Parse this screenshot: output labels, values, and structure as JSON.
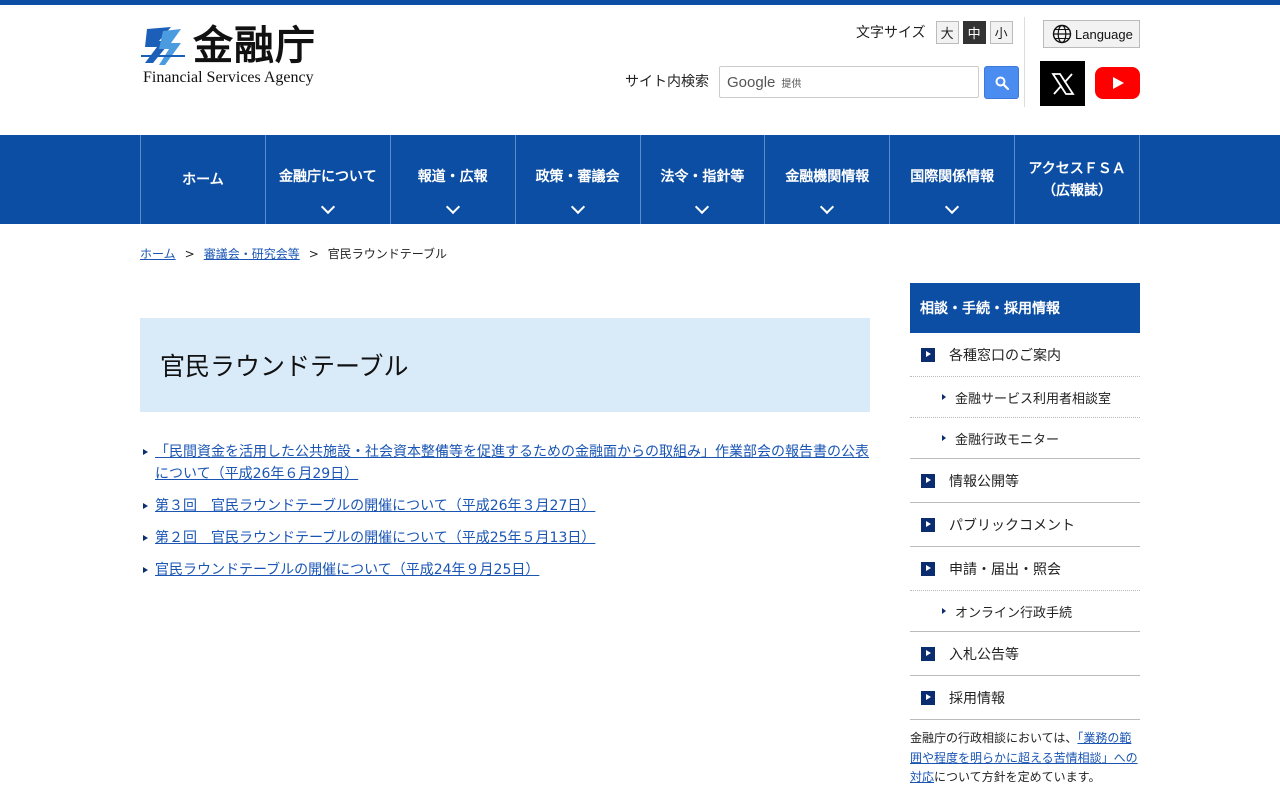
{
  "header": {
    "logo_kanji": "金融庁",
    "logo_en": "Financial Services Agency",
    "font_size_label": "文字サイズ",
    "font_sizes": [
      "大",
      "中",
      "小"
    ],
    "language_label": "Language",
    "search_label": "サイト内検索",
    "search_brand": "Google",
    "search_brand_suffix": "提供",
    "search_placeholder": ""
  },
  "nav": {
    "items": [
      {
        "label": "ホーム"
      },
      {
        "label": "金融庁について"
      },
      {
        "label": "報道・広報"
      },
      {
        "label": "政策・審議会"
      },
      {
        "label": "法令・指針等"
      },
      {
        "label": "金融機関情報"
      },
      {
        "label": "国際関係情報"
      },
      {
        "label": "アクセスＦＳＡ",
        "label2": "（広報誌）"
      }
    ]
  },
  "breadcrumb": {
    "home": "ホーム",
    "parent": "審議会・研究会等",
    "current": "官民ラウンドテーブル",
    "separator": ">"
  },
  "main": {
    "title": "官民ラウンドテーブル",
    "links": [
      "「民間資金を活用した公共施設・社会資本整備等を促進するための金融面からの取組み」作業部会の報告書の公表について（平成26年６月29日）",
      "第３回　官民ラウンドテーブルの開催について（平成26年３月27日）",
      "第２回　官民ラウンドテーブルの開催について（平成25年５月13日）",
      "官民ラウンドテーブルの開催について（平成24年９月25日）"
    ]
  },
  "sidebar": {
    "heading": "相談・手続・採用情報",
    "items": [
      {
        "label": "各種窓口のご案内"
      },
      {
        "label": "金融サービス利用者相談室"
      },
      {
        "label": "金融行政モニター"
      },
      {
        "label": "情報公開等"
      },
      {
        "label": "パブリックコメント"
      },
      {
        "label": "申請・届出・照会"
      },
      {
        "label": "オンライン行政手続"
      },
      {
        "label": "入札公告等"
      },
      {
        "label": "採用情報"
      }
    ],
    "note_prefix": "金融庁の行政相談においては、",
    "note_link": "「業務の範囲や程度を明らかに超える苦情相談」への対応",
    "note_suffix": "について方針を定めています。"
  },
  "colors": {
    "brand_blue": "#0c4ea3",
    "title_bg": "#d9eaf8",
    "link": "#1a55b4"
  },
  "icons": [
    "globe-icon",
    "search-icon",
    "x-logo-icon",
    "youtube-icon"
  ]
}
